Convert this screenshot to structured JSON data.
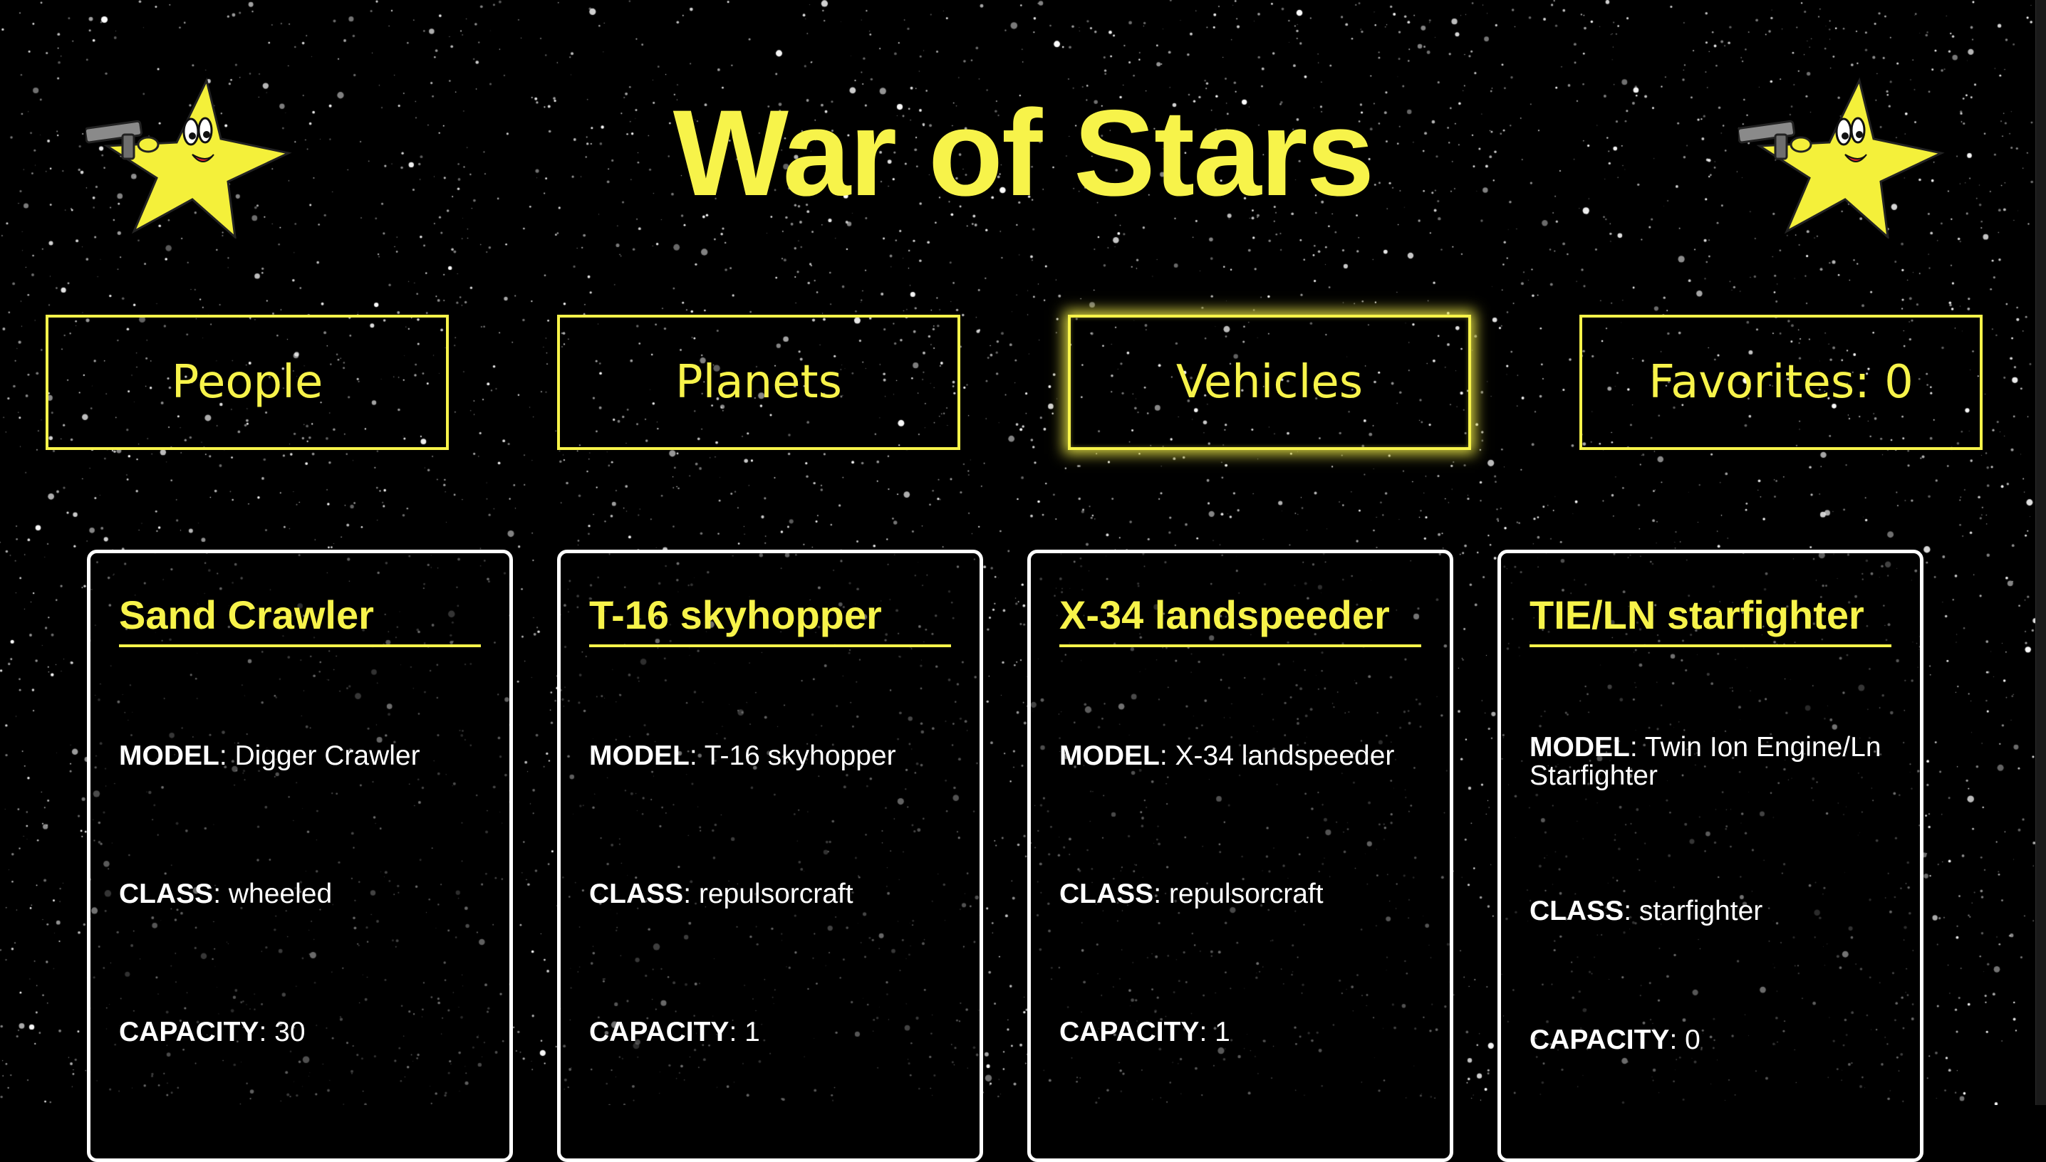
{
  "app": {
    "title": "War of Stars"
  },
  "nav": {
    "items": [
      {
        "label": "People",
        "active": false
      },
      {
        "label": "Planets",
        "active": false
      },
      {
        "label": "Vehicles",
        "active": true
      },
      {
        "label": "Favorites: 0",
        "active": false
      }
    ]
  },
  "cards": [
    {
      "title": "Sand Crawler",
      "fields": [
        {
          "key": "MODEL",
          "sep": ": ",
          "value": "Digger Crawler"
        },
        {
          "key": "CLASS",
          "sep": ": ",
          "value": "wheeled"
        },
        {
          "key": "CAPACITY",
          "sep": ": ",
          "value": "30"
        }
      ]
    },
    {
      "title": "T-16 skyhopper",
      "fields": [
        {
          "key": "MODEL",
          "sep": ": ",
          "value": "T-16 skyhopper"
        },
        {
          "key": "CLASS",
          "sep": ": ",
          "value": "repulsorcraft"
        },
        {
          "key": "CAPACITY",
          "sep": ": ",
          "value": "1"
        }
      ]
    },
    {
      "title": "X-34 landspeeder",
      "fields": [
        {
          "key": "MODEL",
          "sep": ": ",
          "value": "X-34 landspeeder"
        },
        {
          "key": "CLASS",
          "sep": ": ",
          "value": "repulsorcraft"
        },
        {
          "key": "CAPACITY",
          "sep": ": ",
          "value": "1"
        }
      ]
    },
    {
      "title": "TIE/LN starfighter",
      "fields": [
        {
          "key": "MODEL",
          "sep": ": ",
          "value": "Twin Ion Engine/Ln Starfighter"
        },
        {
          "key": "CLASS",
          "sep": ": ",
          "value": "starfighter"
        },
        {
          "key": "CAPACITY",
          "sep": ": ",
          "value": "0"
        }
      ]
    }
  ],
  "theme": {
    "accent": "#f7f34a",
    "background": "#000000",
    "card_border": "#ffffff",
    "text": "#ffffff"
  },
  "icons": {
    "mascot": "star-mascot-with-blaster-icon"
  }
}
